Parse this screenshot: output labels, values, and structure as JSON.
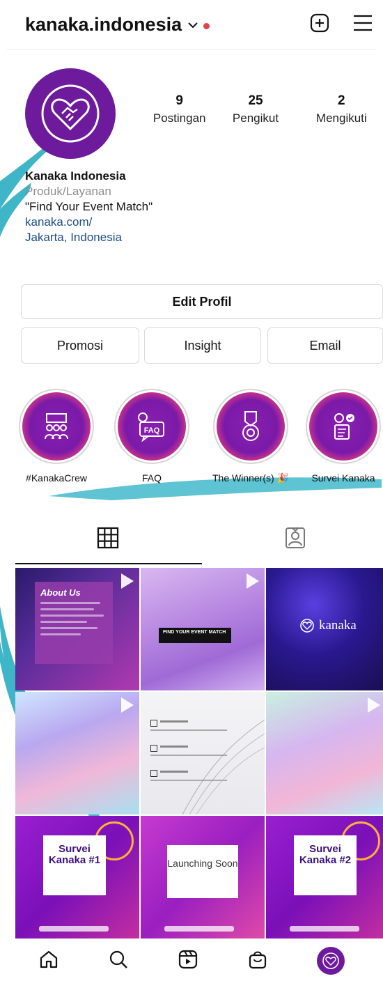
{
  "header": {
    "username": "kanaka.indonesia",
    "live_dot_color": "#e63f4d",
    "icons": [
      "chevron-down-icon",
      "new-post-icon",
      "menu-icon"
    ]
  },
  "profile": {
    "stats": [
      {
        "num": "9",
        "label": "Postingan"
      },
      {
        "num": "25",
        "label": "Pengikut"
      },
      {
        "num": "2",
        "label": "Mengikuti"
      }
    ],
    "name": "Kanaka Indonesia",
    "category": "Produk/Layanan",
    "tagline": "\"Find Your Event Match\"",
    "link": "kanaka.com/",
    "location": "Jakarta, Indonesia"
  },
  "buttons": {
    "edit": "Edit Profil",
    "promo": "Promosi",
    "insight": "Insight",
    "email": "Email"
  },
  "highlights": [
    {
      "label": "#KanakaCrew",
      "icon": "crew-icon"
    },
    {
      "label": "FAQ",
      "icon": "faq-icon"
    },
    {
      "label": "The Winner(s) 🎉",
      "icon": "medal-icon"
    },
    {
      "label": "Survei Kanaka",
      "icon": "survey-icon"
    }
  ],
  "tabs": [
    "grid-icon",
    "tagged-icon"
  ],
  "posts": {
    "p1_title": "About Us",
    "p2_text": "FIND YOUR EVENT MATCH",
    "p3_brand": "kanaka",
    "p7_title": "Survei Kanaka #1",
    "p8_title": "Launching Soon",
    "p9_title": "Survei Kanaka #2"
  },
  "nav": [
    "home-icon",
    "search-icon",
    "reels-icon",
    "shop-icon",
    "profile-avatar"
  ],
  "colors": {
    "brand_purple": "#6e1a9c",
    "link_blue": "#1d4c8a",
    "accent_teal": "#3fb5c8"
  }
}
